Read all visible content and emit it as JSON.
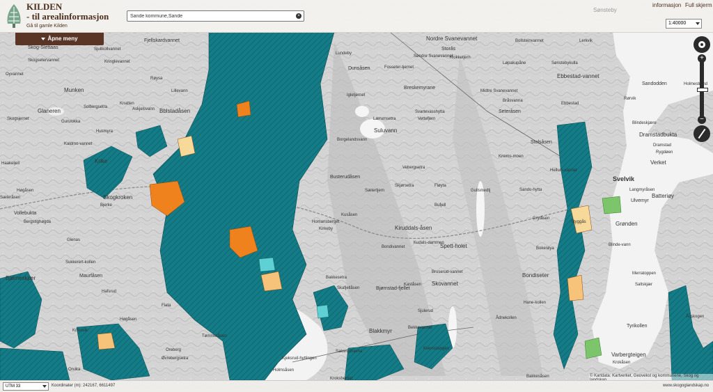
{
  "header": {
    "title_line1": "KILDEN",
    "title_line2": "- til arealinformasjon",
    "old_link": "Gå til gamle Kilden",
    "faded_place": "Sønsteby",
    "links": [
      "informasjon",
      "Full skjerm"
    ]
  },
  "search": {
    "value": "Sande kommune,Sande",
    "clear_icon": "close-icon"
  },
  "scale_select": {
    "selected": "1:40000"
  },
  "menu_button": {
    "label": "Åpne meny",
    "icon": "caret-down-icon"
  },
  "nav_controls": {
    "zoom_in": "+",
    "zoom_out": "−",
    "icons": [
      "pan-icon",
      "zoom-slider",
      "compass-icon"
    ]
  },
  "bottom": {
    "crs_selected": "UTM 33",
    "coordinates": "Koordinater (m): 242167, 6611497",
    "site": "www.skogoglandskap.no"
  },
  "attribution": "© Kartdata: Kartverket, Geovekst og kommunene, Skog og landskap",
  "map_labels": [
    "Fjellskardvannet",
    "Nordre Svanevannet",
    "Storås",
    "Bollsteinvannet",
    "Lerkvik",
    "Skog-Slettaas",
    "Sjulikollvannet",
    "Skogsetervannet",
    "Kringlevannet",
    "Lundeby",
    "Dunsåsen",
    "Fosseter-tjernet",
    "Søndre Svanevannet",
    "Klokketjern",
    "Løpakupåne",
    "Sønstebykulla",
    "Oyvannet",
    "Munken",
    "Røysa",
    "Igletjernet",
    "Breskemyrane",
    "Ebbestad-vannet",
    "Sandodden",
    "Glaneren",
    "Solbergsetra",
    "Knatten",
    "Askjelsvann",
    "Bblstadåsen",
    "Lillevann",
    "Skogsjernet",
    "Midtre Svanevannet",
    "Bråsvanna",
    "Rørvik",
    "Holmestrand",
    "Gurulokka",
    "Husmyra",
    "Lærumsetra",
    "Svartevasshytta",
    "Seteråsen",
    "Ebbestad",
    "Blindeskjære",
    "Dramstadbukta",
    "Kaldmo-vannet",
    "Krike",
    "Suluvann",
    "Borgelandsvann",
    "Vettefjern",
    "Stolsåsen",
    "Dramstad",
    "Rygdøen",
    "Haakeljell",
    "Skogkroken",
    "Bjerke",
    "Busterudåsen",
    "Vebergsetra",
    "Knems-moen",
    "Hellum-vannet",
    "Svelvik",
    "Verket",
    "Høgåsen",
    "Sæteråsen",
    "Sætertjern",
    "Skjørsetra",
    "Fløyta",
    "Gullsmedtj",
    "Sando-hytta",
    "Langmyråsen",
    "Batteriøy",
    "Vollebukta",
    "Bergstighøgda",
    "Kusåsen",
    "Bufjell",
    "Ulvemyr",
    "Grønden",
    "Homansberget",
    "Kirkeby",
    "Kiruddals-åsen",
    "Grytåsen",
    "Styggås",
    "Glenas",
    "Bondivannet",
    "Kudals-dammen",
    "Spett-holet",
    "Blinde-vann",
    "Bokerøya",
    "Sukkerert-kollen",
    "Maurfåsen",
    "Bondiseter",
    "Merratoppen",
    "Saltskjær",
    "Bjørneskjær",
    "Hafsrud",
    "Bakkesetra",
    "Skafjellåsen",
    "Bjørnstad-fjellet",
    "Kaståsen",
    "Bruserud-vannet",
    "Skovannet",
    "Flata",
    "Hane-kollen",
    "Ådnekollen",
    "Høgåsen",
    "Blakkmyr",
    "Sjulerud",
    "Bekkevannet",
    "Tyrikollen",
    "Åsskogen",
    "Knivsvik",
    "Tømmeråsen",
    "Oreberg",
    "Øvrebergsetra",
    "Kjeksrud-hyttingen",
    "Holmsåsen",
    "Saksrudhavna",
    "Kvernstangen",
    "Varbergteigen",
    "Krokåsen",
    "Kroksberget",
    "Orvika",
    "Bakkesåsen",
    "Kjellerasen"
  ]
}
